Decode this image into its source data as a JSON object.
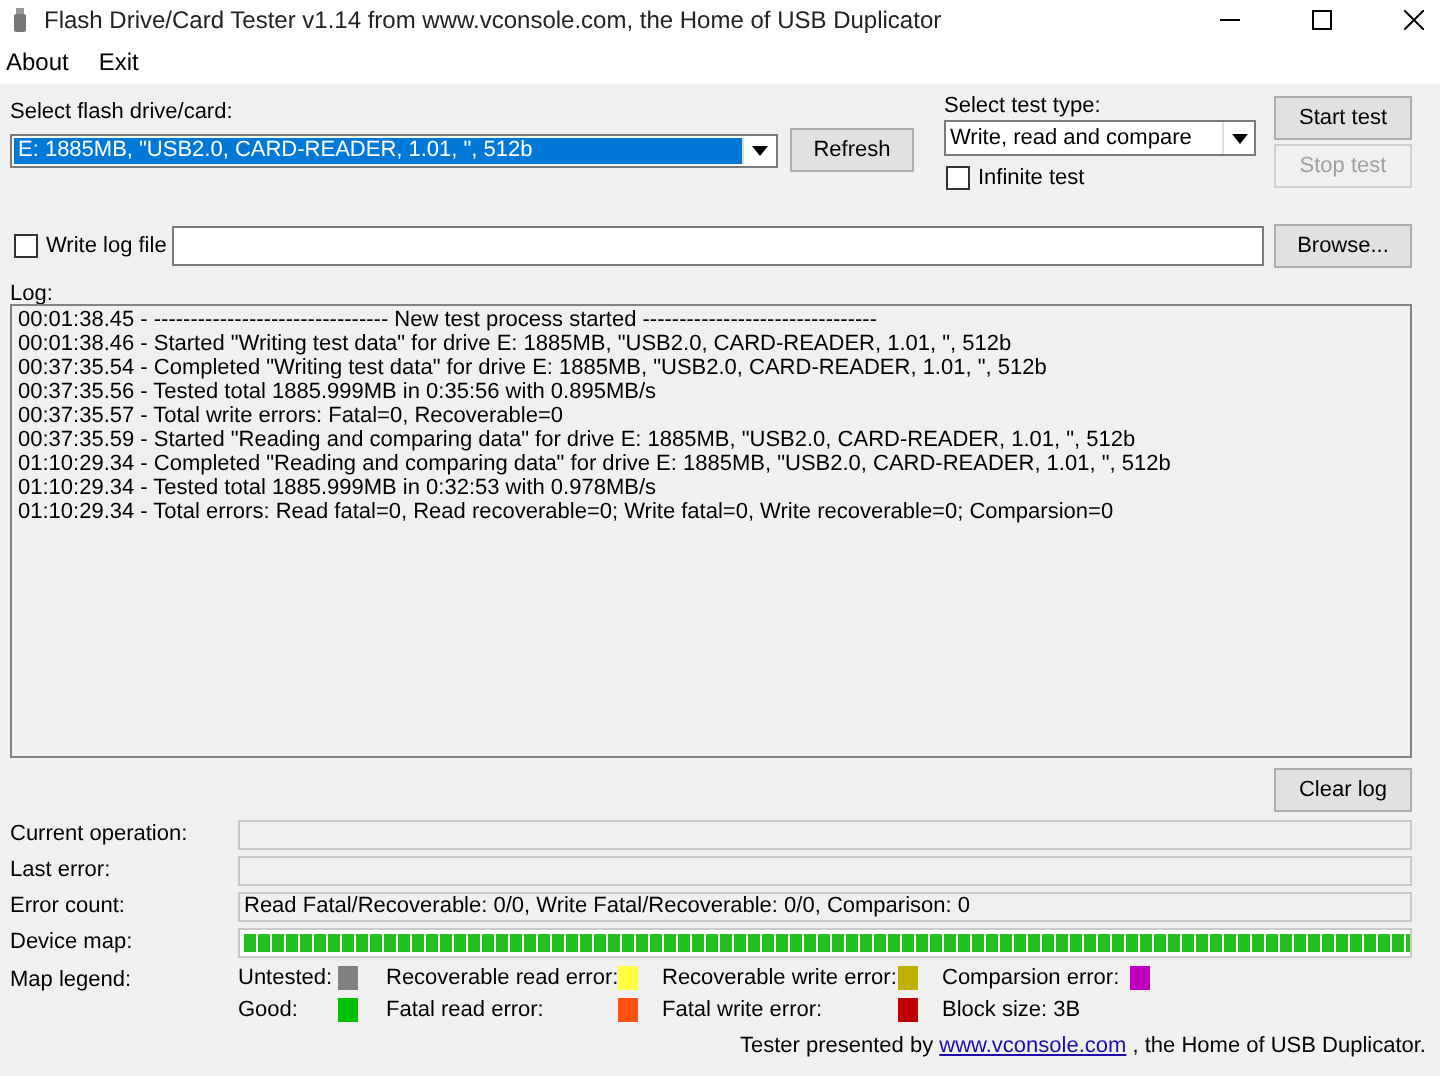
{
  "window": {
    "title": "Flash Drive/Card Tester v1.14 from www.vconsole.com, the Home of USB Duplicator"
  },
  "menu": [
    "About",
    "Exit"
  ],
  "drive": {
    "label": "Select flash drive/card:",
    "value": "E: 1885MB, \"USB2.0, CARD-READER, 1.01, \", 512b",
    "refresh": "Refresh"
  },
  "test_type": {
    "label": "Select test type:",
    "value": "Write, read and compare",
    "infinite": {
      "label": "Infinite test",
      "checked": false
    }
  },
  "buttons": [
    {
      "label": "Start test",
      "disabled": false
    },
    {
      "label": "Stop test",
      "disabled": true
    }
  ],
  "log_file": {
    "label": "Write log file",
    "checked": false,
    "browse": "Browse..."
  },
  "log": {
    "label": "Log:",
    "lines": [
      "00:01:38.45 - -------------------------------- New test process started --------------------------------",
      "00:01:38.46 - Started \"Writing test data\" for drive E: 1885MB, \"USB2.0, CARD-READER, 1.01, \", 512b",
      "00:37:35.54 - Completed \"Writing test data\" for drive E: 1885MB, \"USB2.0, CARD-READER, 1.01, \", 512b",
      "00:37:35.56 - Tested total 1885.999MB in 0:35:56 with  0.895MB/s",
      "00:37:35.57 - Total write errors: Fatal=0, Recoverable=0",
      "00:37:35.59 - Started \"Reading and comparing data\" for drive E: 1885MB, \"USB2.0, CARD-READER, 1.01, \", 512b",
      "01:10:29.34 - Completed \"Reading and comparing data\" for drive E: 1885MB, \"USB2.0, CARD-READER, 1.01, \", 512b",
      "01:10:29.34 - Tested total 1885.999MB in 0:32:53 with  0.978MB/s",
      "01:10:29.34 - Total errors: Read fatal=0, Read recoverable=0; Write fatal=0, Write recoverable=0; Comparsion=0"
    ],
    "clear": "Clear log"
  },
  "status": [
    {
      "label": "Current operation:"
    },
    {
      "label": "Last error:"
    },
    {
      "label": "Error count:",
      "value": "Read Fatal/Recoverable: 0/0, Write Fatal/Recoverable: 0/0, Comparison: 0"
    }
  ],
  "device_map": {
    "label": "Device map:"
  },
  "legend": {
    "label": "Map legend:",
    "items": [
      {
        "label": "Untested:",
        "color": "#808080"
      },
      {
        "label": "Recoverable read error:",
        "color": "#ffff40"
      },
      {
        "label": "Recoverable write error:",
        "color": "#c0b000"
      },
      {
        "label": "Comparsion error:",
        "color": "#c000c0"
      },
      {
        "label": "Good:",
        "color": "#00c000"
      },
      {
        "label": "Fatal read error:",
        "color": "#ff5010"
      },
      {
        "label": "Fatal write error:",
        "color": "#c00000"
      },
      {
        "label": "Block size: 3B"
      }
    ]
  },
  "footer": {
    "before": "Tester presented by",
    "link": "www.vconsole.com",
    "after": ", the Home of USB Duplicator."
  }
}
